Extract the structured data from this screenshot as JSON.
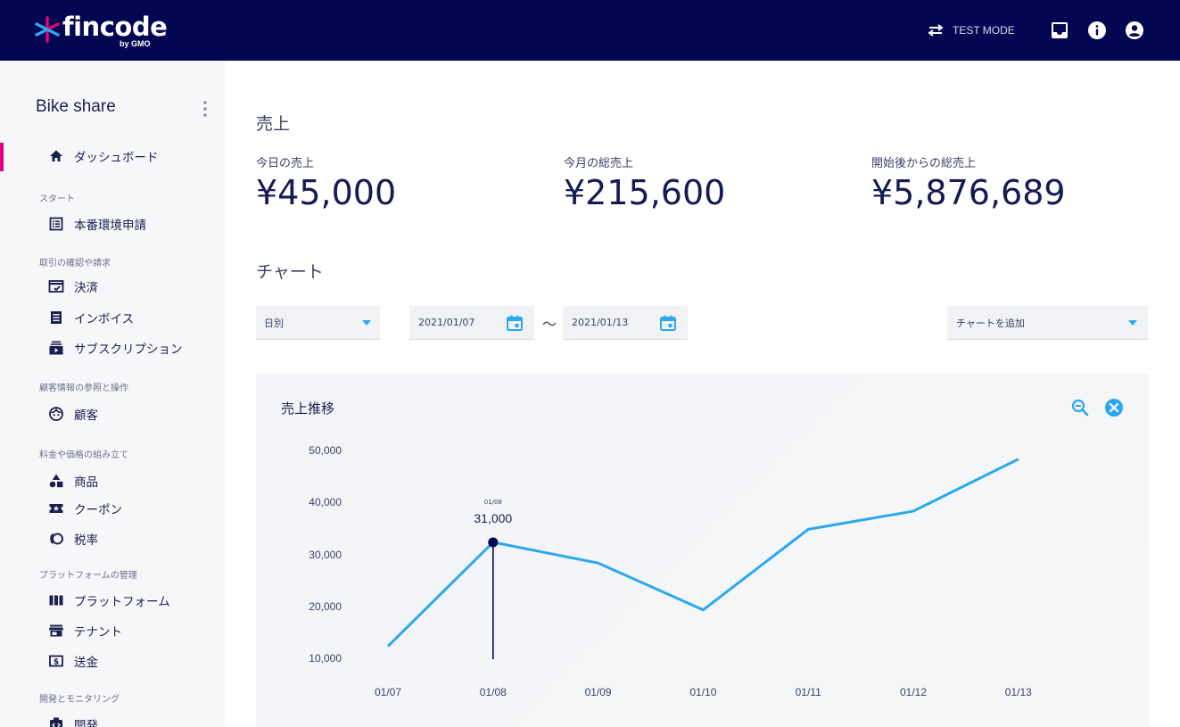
{
  "header": {
    "logo_text": "fincode",
    "logo_sub": "by GMO",
    "mode_label": "TEST MODE",
    "icons": [
      "swap-icon",
      "inbox-icon",
      "info-icon",
      "account-icon"
    ],
    "background": "#030752"
  },
  "sidebar": {
    "project_name": "Bike share",
    "active_color": "#e4007f",
    "items": [
      {
        "label": "ダッシュボード",
        "icon": "home-icon",
        "active": true
      },
      {
        "section": "スタート"
      },
      {
        "label": "本番環境申請",
        "icon": "list-icon"
      },
      {
        "section": "取引の確認や請求"
      },
      {
        "label": "決済",
        "icon": "payment-icon"
      },
      {
        "label": "インボイス",
        "icon": "invoice-icon"
      },
      {
        "label": "サブスクリプション",
        "icon": "subscription-icon"
      },
      {
        "section": "顧客情報の参照と操作"
      },
      {
        "label": "顧客",
        "icon": "customer-icon"
      },
      {
        "section": "料金や価格の組み立て"
      },
      {
        "label": "商品",
        "icon": "product-icon"
      },
      {
        "label": "クーポン",
        "icon": "coupon-icon"
      },
      {
        "label": "税率",
        "icon": "tax-icon"
      },
      {
        "section": "プラットフォームの管理"
      },
      {
        "label": "プラットフォーム",
        "icon": "platform-icon"
      },
      {
        "label": "テナント",
        "icon": "tenant-icon"
      },
      {
        "label": "送金",
        "icon": "transfer-icon"
      },
      {
        "section": "開発とモニタリング"
      },
      {
        "label": "開発",
        "icon": "dev-icon"
      }
    ]
  },
  "main": {
    "sales_heading": "売上",
    "stats": [
      {
        "label": "今日の売上",
        "value": "¥45,000"
      },
      {
        "label": "今月の総売上",
        "value": "¥215,600"
      },
      {
        "label": "開始後からの総売上",
        "value": "¥5,876,689"
      }
    ],
    "chart_heading": "チャート",
    "controls": {
      "period": "日別",
      "date_from": "2021/01/07",
      "range_separator": "〜",
      "date_to": "2021/01/13",
      "add_chart": "チャートを追加"
    },
    "accent_color": "#2ca8ee"
  },
  "chart_data": {
    "type": "line",
    "title": "売上推移",
    "categories": [
      "01/07",
      "01/08",
      "01/09",
      "01/10",
      "01/11",
      "01/12",
      "01/13"
    ],
    "series": [
      {
        "values": [
          12500,
          32500,
          28500,
          19500,
          35000,
          38500,
          48500
        ]
      }
    ],
    "ylim": [
      10000,
      50000
    ],
    "yticks": [
      "50,000",
      "40,000",
      "30,000",
      "20,000",
      "10,000"
    ],
    "tooltip": {
      "date": "01/08",
      "value": "31,000"
    },
    "grid": false,
    "legend": "none"
  }
}
